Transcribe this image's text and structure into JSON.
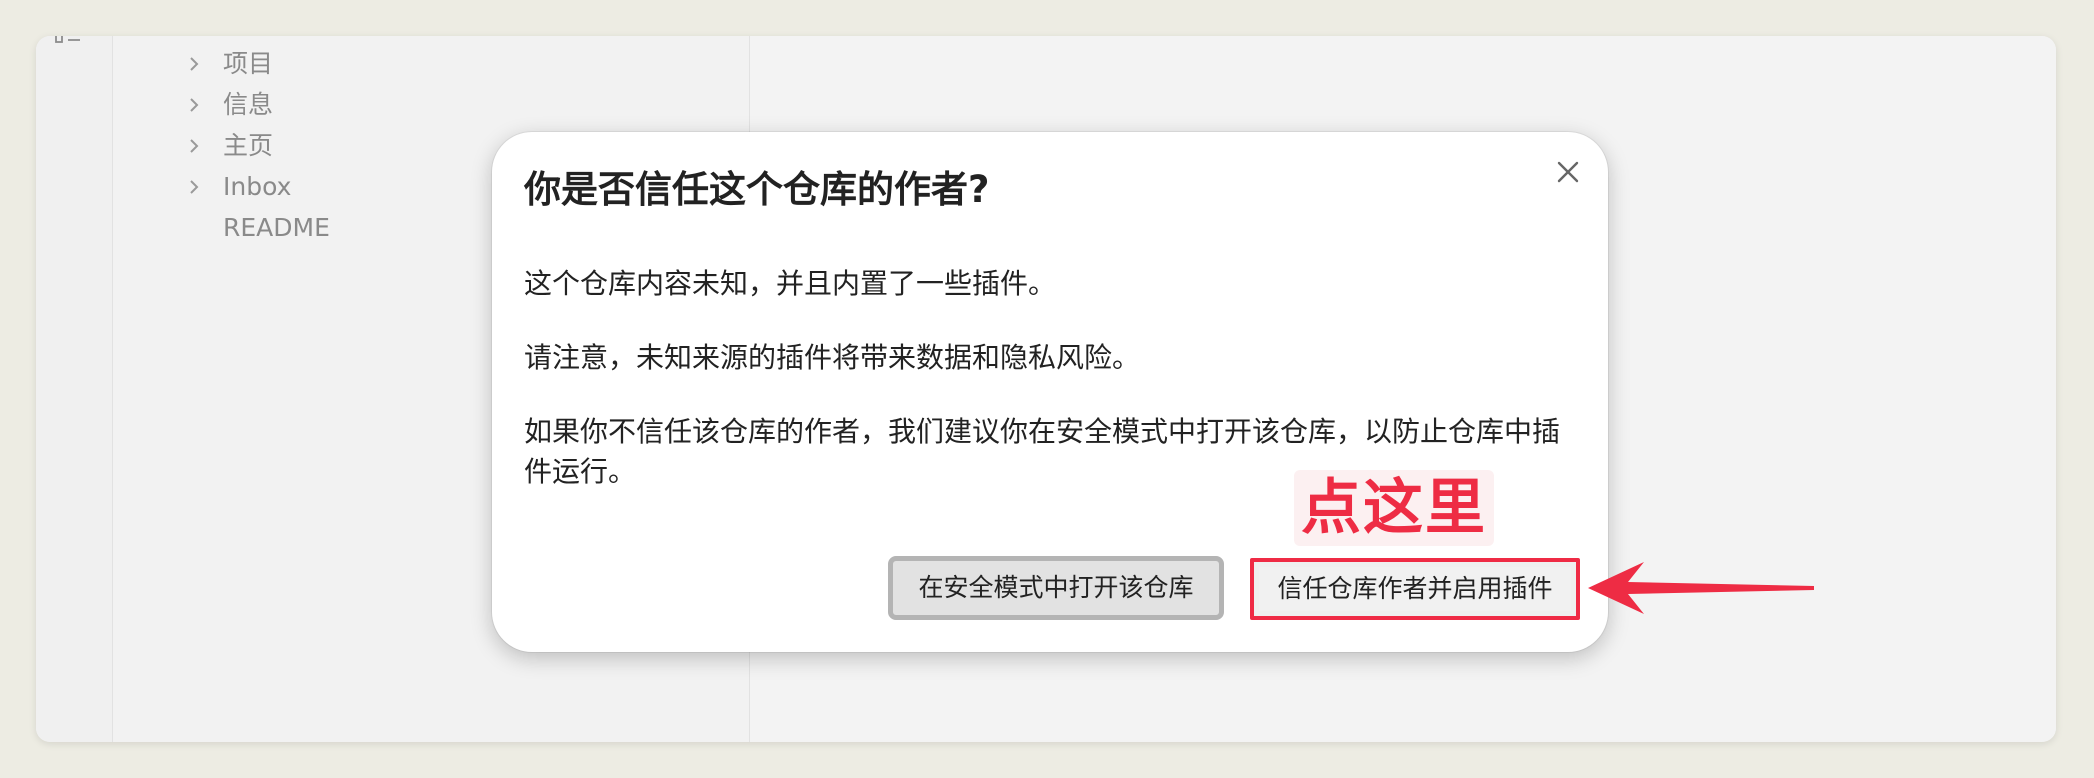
{
  "sidebar": {
    "items": [
      {
        "label": "项目",
        "has_chevron": true
      },
      {
        "label": "信息",
        "has_chevron": true
      },
      {
        "label": "主页",
        "has_chevron": true
      },
      {
        "label": "Inbox",
        "has_chevron": true
      },
      {
        "label": "README",
        "has_chevron": false
      }
    ]
  },
  "dialog": {
    "title": "你是否信任这个仓库的作者?",
    "paragraphs": [
      "这个仓库内容未知，并且内置了一些插件。",
      "请注意，未知来源的插件将带来数据和隐私风险。",
      "如果你不信任该仓库的作者，我们建议你在安全模式中打开该仓库，以防止仓库中插件运行。"
    ],
    "safe_mode_button": "在安全模式中打开该仓库",
    "trust_button": "信任仓库作者并启用插件",
    "close_icon": "close-icon"
  },
  "annotation": {
    "callout_text": "点这里",
    "color": "#ee2c44"
  },
  "colors": {
    "background": "#edece3",
    "accent_red": "#ef2b45"
  }
}
